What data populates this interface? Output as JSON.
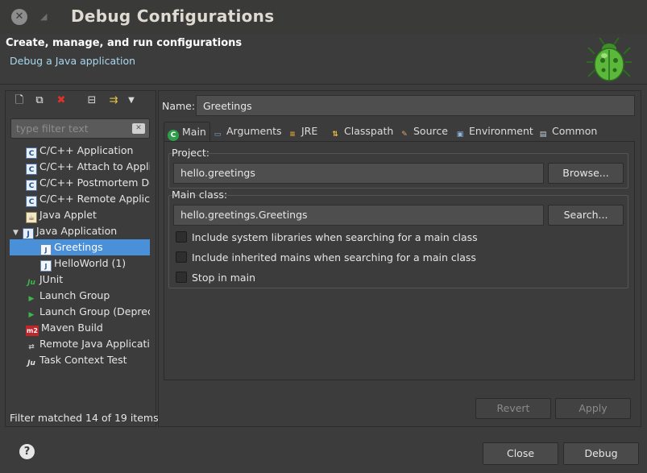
{
  "window": {
    "title": "Debug Configurations"
  },
  "banner": {
    "title": "Create, manage, and run configurations",
    "subtitle": "Debug a Java application"
  },
  "left": {
    "filter_placeholder": "type filter text",
    "items": [
      {
        "label": "C/C++ Application",
        "icon": "c-app-icon"
      },
      {
        "label": "C/C++ Attach to Application",
        "icon": "c-attach-icon"
      },
      {
        "label": "C/C++ Postmortem Debugger",
        "icon": "c-postmortem-icon"
      },
      {
        "label": "C/C++ Remote Application",
        "icon": "c-remote-icon"
      },
      {
        "label": "Java Applet",
        "icon": "java-applet-icon"
      },
      {
        "label": "Java Application",
        "icon": "java-app-icon"
      },
      {
        "label": "Greetings",
        "icon": "java-config-icon"
      },
      {
        "label": "HelloWorld (1)",
        "icon": "java-config-icon"
      },
      {
        "label": "JUnit",
        "icon": "junit-icon"
      },
      {
        "label": "Launch Group",
        "icon": "launch-group-icon"
      },
      {
        "label": "Launch Group (Deprecated)",
        "icon": "launch-group-deprecated-icon"
      },
      {
        "label": "Maven Build",
        "icon": "maven-icon"
      },
      {
        "label": "Remote Java Application",
        "icon": "remote-java-icon"
      },
      {
        "label": "Task Context Test",
        "icon": "task-context-icon"
      }
    ],
    "status": "Filter matched 14 of 19 items"
  },
  "right": {
    "name_label": "Name:",
    "name_value": "Greetings",
    "tabs": [
      {
        "label": "Main",
        "icon": "main-icon"
      },
      {
        "label": "Arguments",
        "icon": "arguments-icon"
      },
      {
        "label": "JRE",
        "icon": "jre-icon"
      },
      {
        "label": "Classpath",
        "icon": "classpath-icon"
      },
      {
        "label": "Source",
        "icon": "source-icon"
      },
      {
        "label": "Environment",
        "icon": "environment-icon"
      },
      {
        "label": "Common",
        "icon": "common-icon"
      }
    ],
    "project_label": "Project:",
    "project_value": "hello.greetings",
    "browse_label": "Browse...",
    "main_class_label": "Main class:",
    "main_class_value": "hello.greetings.Greetings",
    "search_label": "Search...",
    "checkboxes": [
      {
        "label": "Include system libraries when searching for a main class",
        "checked": false
      },
      {
        "label": "Include inherited mains when searching for a main class",
        "checked": false
      },
      {
        "label": "Stop in main",
        "checked": false
      }
    ],
    "revert_label": "Revert",
    "apply_label": "Apply"
  },
  "footer": {
    "close_label": "Close",
    "debug_label": "Debug"
  },
  "colors": {
    "background": "#3c3c3c",
    "selection": "#4a90d9",
    "banner_subtitle": "#a8d8ee"
  }
}
